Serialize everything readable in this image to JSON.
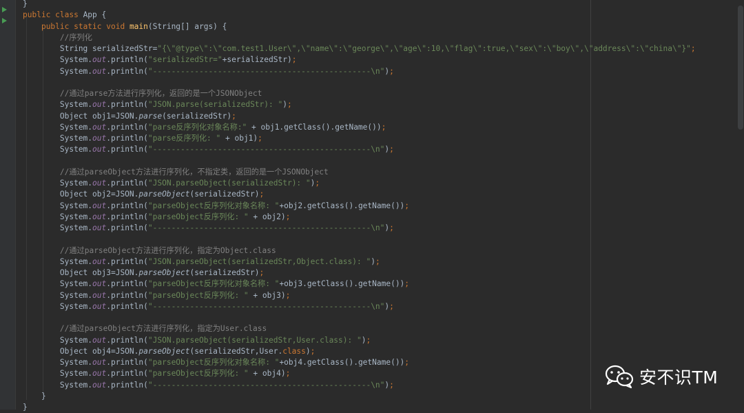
{
  "gutter": {
    "run_icon": "run-triangle-icon",
    "run_color": "#499c54"
  },
  "colors": {
    "background": "#2b2b2b",
    "plain": "#a9b7c6",
    "keyword": "#cc7832",
    "string": "#6a8759",
    "comment": "#808080",
    "function": "#ffc66d",
    "static_field": "#9876aa"
  },
  "code_lines": [
    [
      [
        "plain",
        "}"
      ]
    ],
    [
      [
        "kw",
        "public class "
      ],
      [
        "plain",
        "App {"
      ]
    ],
    [
      [
        "plain",
        "    "
      ],
      [
        "kw",
        "public static void "
      ],
      [
        "fn",
        "main"
      ],
      [
        "plain",
        "(String[] args) {"
      ]
    ],
    [
      [
        "comment",
        "        //序列化"
      ]
    ],
    [
      [
        "plain",
        "        String serializedStr="
      ],
      [
        "str",
        "\"{\\\"@type\\\":\\\"com.test1.User\\\",\\\"name\\\":\\\"george\\\",\\\"age\\\":10,\\\"flag\\\":true,\\\"sex\\\":\\\"boy\\\",\\\"address\\\":\\\"china\\\"}\""
      ],
      [
        "kw",
        ";"
      ]
    ],
    [
      [
        "plain",
        "        System."
      ],
      [
        "static",
        "out"
      ],
      [
        "plain",
        ".println("
      ],
      [
        "str",
        "\"serializedStr=\""
      ],
      [
        "plain",
        "+serializedStr)"
      ],
      [
        "kw",
        ";"
      ]
    ],
    [
      [
        "plain",
        "        System."
      ],
      [
        "static",
        "out"
      ],
      [
        "plain",
        ".println("
      ],
      [
        "str",
        "\"-----------------------------------------------\\n\""
      ],
      [
        "plain",
        ")"
      ],
      [
        "kw",
        ";"
      ]
    ],
    [],
    [
      [
        "comment",
        "        //通过parse方法进行序列化，返回的是一个JSONObject"
      ]
    ],
    [
      [
        "plain",
        "        System."
      ],
      [
        "static",
        "out"
      ],
      [
        "plain",
        ".println("
      ],
      [
        "str",
        "\"JSON.parse(serializedStr): \""
      ],
      [
        "plain",
        ")"
      ],
      [
        "kw",
        ";"
      ]
    ],
    [
      [
        "plain",
        "        Object obj1=JSON."
      ],
      [
        "italic",
        "parse"
      ],
      [
        "plain",
        "(serializedStr)"
      ],
      [
        "kw",
        ";"
      ]
    ],
    [
      [
        "plain",
        "        System."
      ],
      [
        "static",
        "out"
      ],
      [
        "plain",
        ".println("
      ],
      [
        "str",
        "\"parse反序列化对象名称:\""
      ],
      [
        "plain",
        " + obj1.getClass().getName())"
      ],
      [
        "kw",
        ";"
      ]
    ],
    [
      [
        "plain",
        "        System."
      ],
      [
        "static",
        "out"
      ],
      [
        "plain",
        ".println("
      ],
      [
        "str",
        "\"parse反序列化: \""
      ],
      [
        "plain",
        " + obj1)"
      ],
      [
        "kw",
        ";"
      ]
    ],
    [
      [
        "plain",
        "        System."
      ],
      [
        "static",
        "out"
      ],
      [
        "plain",
        ".println("
      ],
      [
        "str",
        "\"-----------------------------------------------\\n\""
      ],
      [
        "plain",
        ")"
      ],
      [
        "kw",
        ";"
      ]
    ],
    [],
    [
      [
        "comment",
        "        //通过parseObject方法进行序列化，不指定类，返回的是一个JSONObject"
      ]
    ],
    [
      [
        "plain",
        "        System."
      ],
      [
        "static",
        "out"
      ],
      [
        "plain",
        ".println("
      ],
      [
        "str",
        "\"JSON.parseObject(serializedStr): \""
      ],
      [
        "plain",
        ")"
      ],
      [
        "kw",
        ";"
      ]
    ],
    [
      [
        "plain",
        "        Object obj2=JSON."
      ],
      [
        "italic",
        "parseObject"
      ],
      [
        "plain",
        "(serializedStr)"
      ],
      [
        "kw",
        ";"
      ]
    ],
    [
      [
        "plain",
        "        System."
      ],
      [
        "static",
        "out"
      ],
      [
        "plain",
        ".println("
      ],
      [
        "str",
        "\"parseObject反序列化对象名称: \""
      ],
      [
        "plain",
        "+obj2.getClass().getName())"
      ],
      [
        "kw",
        ";"
      ]
    ],
    [
      [
        "plain",
        "        System."
      ],
      [
        "static",
        "out"
      ],
      [
        "plain",
        ".println("
      ],
      [
        "str",
        "\"parseObject反序列化: \""
      ],
      [
        "plain",
        " + obj2)"
      ],
      [
        "kw",
        ";"
      ]
    ],
    [
      [
        "plain",
        "        System."
      ],
      [
        "static",
        "out"
      ],
      [
        "plain",
        ".println("
      ],
      [
        "str",
        "\"-----------------------------------------------\\n\""
      ],
      [
        "plain",
        ")"
      ],
      [
        "kw",
        ";"
      ]
    ],
    [],
    [
      [
        "comment",
        "        //通过parseObject方法进行序列化，指定为Object.class"
      ]
    ],
    [
      [
        "plain",
        "        System."
      ],
      [
        "static",
        "out"
      ],
      [
        "plain",
        ".println("
      ],
      [
        "str",
        "\"JSON.parseObject(serializedStr,Object.class): \""
      ],
      [
        "plain",
        ")"
      ],
      [
        "kw",
        ";"
      ]
    ],
    [
      [
        "plain",
        "        Object obj3=JSON."
      ],
      [
        "italic",
        "parseObject"
      ],
      [
        "plain",
        "(serializedStr)"
      ],
      [
        "kw",
        ";"
      ]
    ],
    [
      [
        "plain",
        "        System."
      ],
      [
        "static",
        "out"
      ],
      [
        "plain",
        ".println("
      ],
      [
        "str",
        "\"parseObject反序列化对象名称: \""
      ],
      [
        "plain",
        "+obj3.getClass().getName())"
      ],
      [
        "kw",
        ";"
      ]
    ],
    [
      [
        "plain",
        "        System."
      ],
      [
        "static",
        "out"
      ],
      [
        "plain",
        ".println("
      ],
      [
        "str",
        "\"parseObject反序列化: \""
      ],
      [
        "plain",
        " + obj3)"
      ],
      [
        "kw",
        ";"
      ]
    ],
    [
      [
        "plain",
        "        System."
      ],
      [
        "static",
        "out"
      ],
      [
        "plain",
        ".println("
      ],
      [
        "str",
        "\"-----------------------------------------------\\n\""
      ],
      [
        "plain",
        ")"
      ],
      [
        "kw",
        ";"
      ]
    ],
    [],
    [
      [
        "comment",
        "        //通过parseObject方法进行序列化，指定为User.class"
      ]
    ],
    [
      [
        "plain",
        "        System."
      ],
      [
        "static",
        "out"
      ],
      [
        "plain",
        ".println("
      ],
      [
        "str",
        "\"JSON.parseObject(serializedStr,User.class): \""
      ],
      [
        "plain",
        ")"
      ],
      [
        "kw",
        ";"
      ]
    ],
    [
      [
        "plain",
        "        Object obj4=JSON."
      ],
      [
        "italic",
        "parseObject"
      ],
      [
        "plain",
        "(serializedStr,User."
      ],
      [
        "kw",
        "class"
      ],
      [
        "plain",
        ")"
      ],
      [
        "kw",
        ";"
      ]
    ],
    [
      [
        "plain",
        "        System."
      ],
      [
        "static",
        "out"
      ],
      [
        "plain",
        ".println("
      ],
      [
        "str",
        "\"parseObject反序列化对象名称: \""
      ],
      [
        "plain",
        "+obj4.getClass().getName())"
      ],
      [
        "kw",
        ";"
      ]
    ],
    [
      [
        "plain",
        "        System."
      ],
      [
        "static",
        "out"
      ],
      [
        "plain",
        ".println("
      ],
      [
        "str",
        "\"parseObject反序列化: \""
      ],
      [
        "plain",
        " + obj4)"
      ],
      [
        "kw",
        ";"
      ]
    ],
    [
      [
        "plain",
        "        System."
      ],
      [
        "static",
        "out"
      ],
      [
        "plain",
        ".println("
      ],
      [
        "str",
        "\"-----------------------------------------------\\n\""
      ],
      [
        "plain",
        ")"
      ],
      [
        "kw",
        ";"
      ]
    ],
    [
      [
        "plain",
        "    }"
      ]
    ],
    [
      [
        "plain",
        "}"
      ]
    ]
  ],
  "watermark": {
    "icon": "wechat-icon",
    "text": "安不识TM"
  }
}
